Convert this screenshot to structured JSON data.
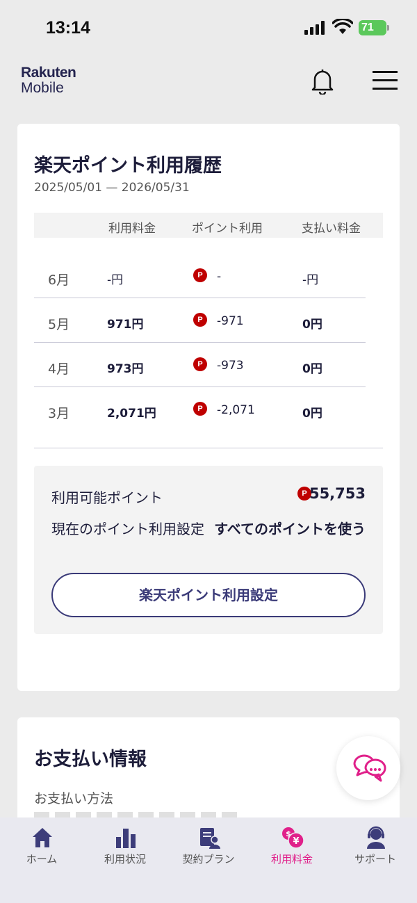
{
  "status_bar": {
    "time": "13:14",
    "battery": "71"
  },
  "header": {
    "logo_line1": "Rakuten",
    "logo_line2": "Mobile"
  },
  "points_history": {
    "title": "楽天ポイント利用履歴",
    "date_range": "2025/05/01 — 2026/05/31",
    "columns": [
      "利用料金",
      "ポイント利用",
      "支払い料金"
    ],
    "point_badge": "P",
    "rows": [
      {
        "month": "6月",
        "fee": "-円",
        "points": "-",
        "payment": "-円"
      },
      {
        "month": "5月",
        "fee": "971円",
        "points": "-971",
        "payment": "0円"
      },
      {
        "month": "4月",
        "fee": "973円",
        "points": "-973",
        "payment": "0円"
      },
      {
        "month": "3月",
        "fee": "2,071円",
        "points": "-2,071",
        "payment": "0円"
      }
    ],
    "available_label": "利用可能ポイント",
    "available_value": "55,753",
    "setting_label": "現在のポイント利用設定",
    "setting_value": "すべてのポイントを使う",
    "setting_button": "楽天ポイント利用設定"
  },
  "payment_info": {
    "title": "お支払い情報",
    "method_label": "お支払い方法"
  },
  "tabbar": {
    "active_color": "#e0208a",
    "items": [
      {
        "label": "ホーム",
        "icon": "home-icon"
      },
      {
        "label": "利用状況",
        "icon": "bar-chart-icon"
      },
      {
        "label": "契約プラン",
        "icon": "contract-icon"
      },
      {
        "label": "利用料金",
        "icon": "yen-icon",
        "active": true
      },
      {
        "label": "サポート",
        "icon": "support-icon"
      }
    ]
  }
}
